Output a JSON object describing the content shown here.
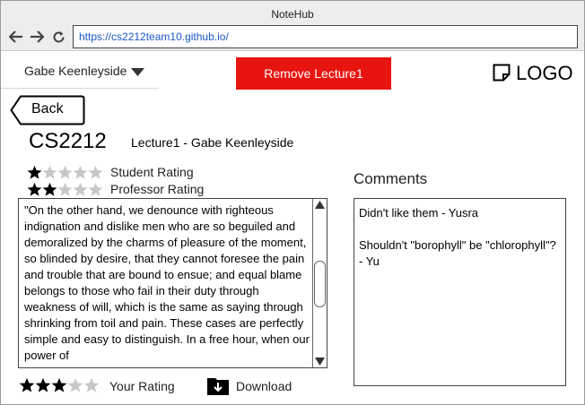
{
  "browser": {
    "title": "NoteHub",
    "url": "https://cs2212team10.github.io/"
  },
  "header": {
    "user_name": "Gabe Keenleyside",
    "remove_button_label": "Remove Lecture1",
    "logo_text": "LOGO"
  },
  "navigation": {
    "back_label": "Back"
  },
  "lecture": {
    "course_code": "CS2212",
    "title": "Lecture1 - Gabe Keenleyside",
    "student_rating": {
      "label": "Student Rating",
      "value": 1,
      "max": 5
    },
    "professor_rating": {
      "label": "Professor Rating",
      "value": 2,
      "max": 5
    },
    "body_text": "\"On the other hand, we denounce with righteous indignation and dislike men who are so beguiled and demoralized by the charms of pleasure of the moment, so blinded by desire, that they cannot foresee the pain and trouble that are bound to ensue; and equal blame belongs to those who fail in their duty through weakness of will, which is the same as saying through shrinking from toil and pain. These cases are perfectly simple and easy to distinguish. In a free hour, when our power of"
  },
  "your_rating": {
    "label": "Your Rating",
    "value": 3,
    "max": 5
  },
  "download": {
    "label": "Download"
  },
  "comments": {
    "label": "Comments",
    "items": [
      "Didn't like them - Yusra",
      "Shouldn't \"borophyll\" be \"chlorophyll\"? - Yu"
    ]
  },
  "colors": {
    "accent_red": "#e8140f",
    "star_filled": "#000000",
    "star_empty": "#c8c8c8"
  }
}
